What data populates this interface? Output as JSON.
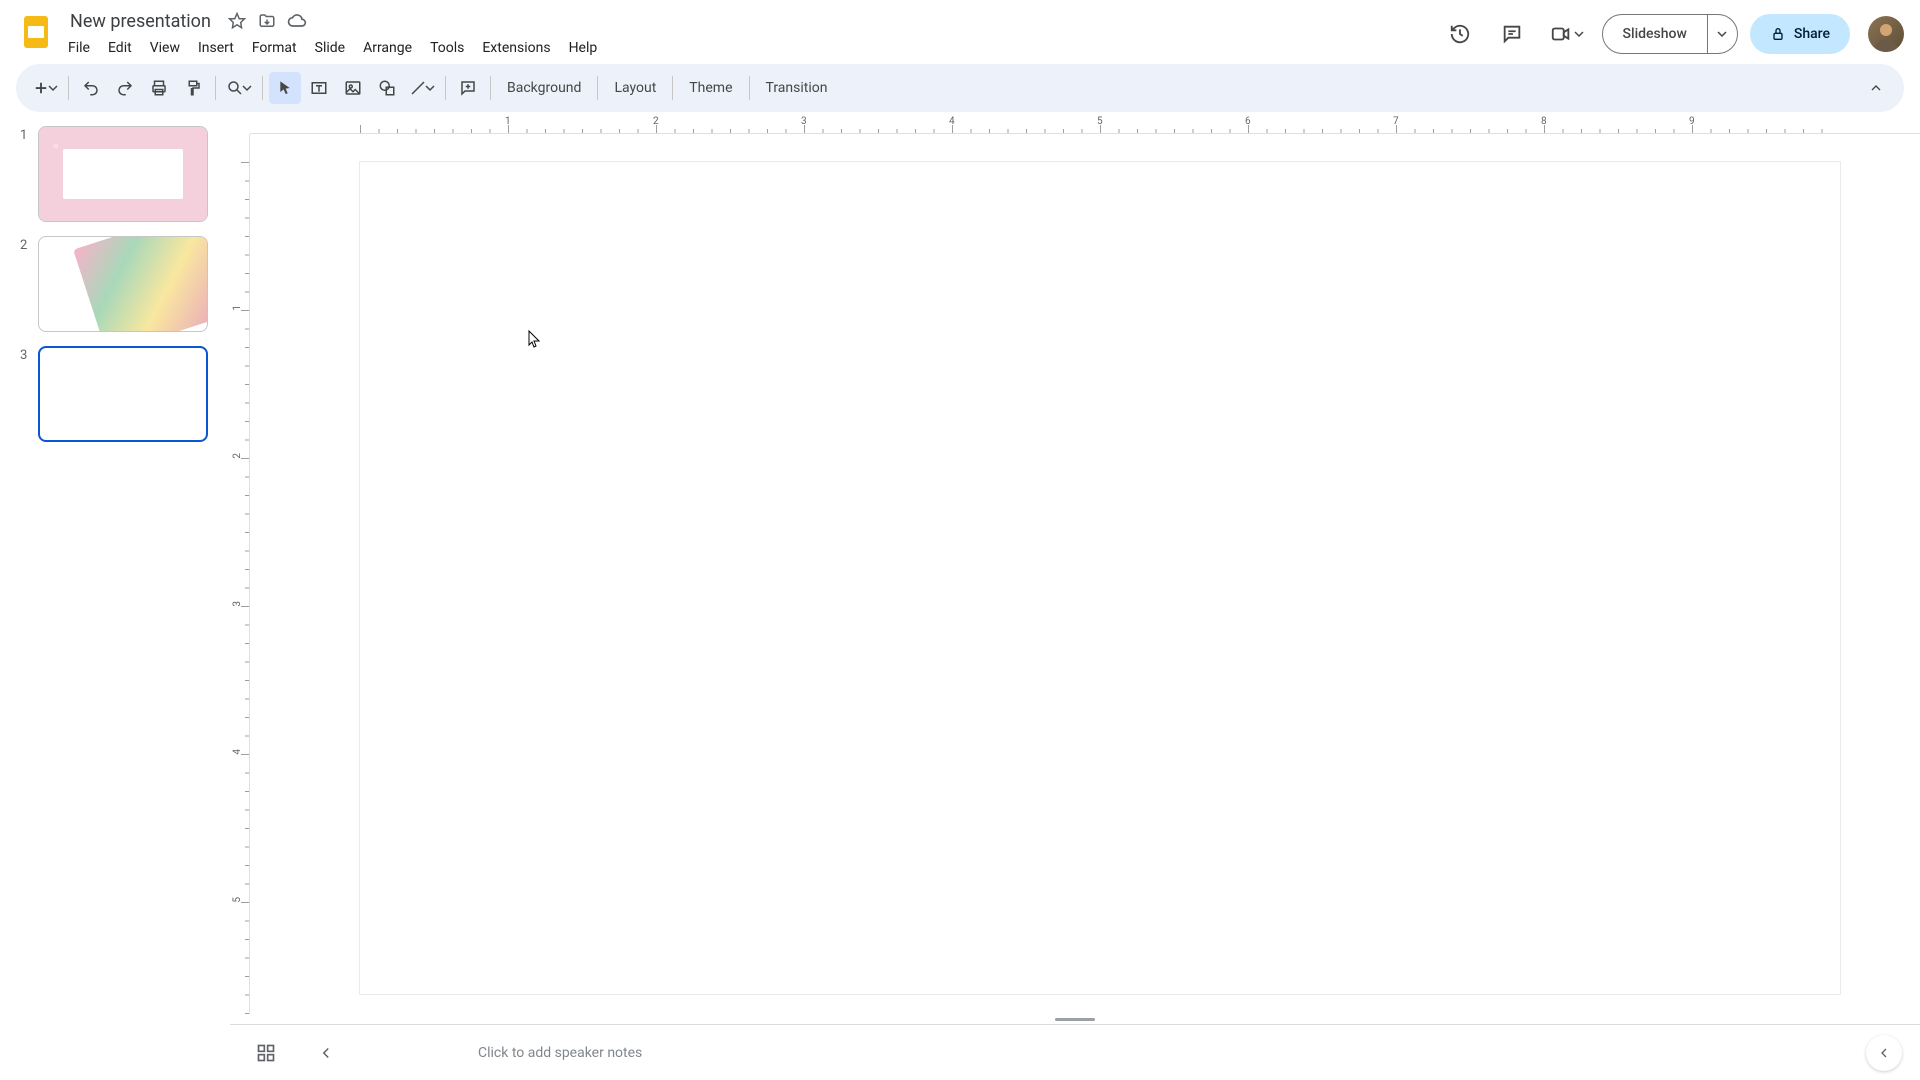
{
  "doc": {
    "title": "New presentation"
  },
  "menu": {
    "items": [
      "File",
      "Edit",
      "View",
      "Insert",
      "Format",
      "Slide",
      "Arrange",
      "Tools",
      "Extensions",
      "Help"
    ]
  },
  "header_buttons": {
    "slideshow": "Slideshow",
    "share": "Share"
  },
  "toolbar": {
    "background": "Background",
    "layout": "Layout",
    "theme": "Theme",
    "transition": "Transition"
  },
  "filmstrip": {
    "slides": [
      {
        "num": "1"
      },
      {
        "num": "2"
      },
      {
        "num": "3"
      }
    ],
    "selected_index": 2
  },
  "ruler": {
    "h_labels": [
      "1",
      "2",
      "3",
      "4",
      "5",
      "6",
      "7",
      "8",
      "9"
    ],
    "v_labels": [
      "1",
      "2",
      "3",
      "4",
      "5"
    ]
  },
  "notes": {
    "placeholder": "Click to add speaker notes"
  }
}
